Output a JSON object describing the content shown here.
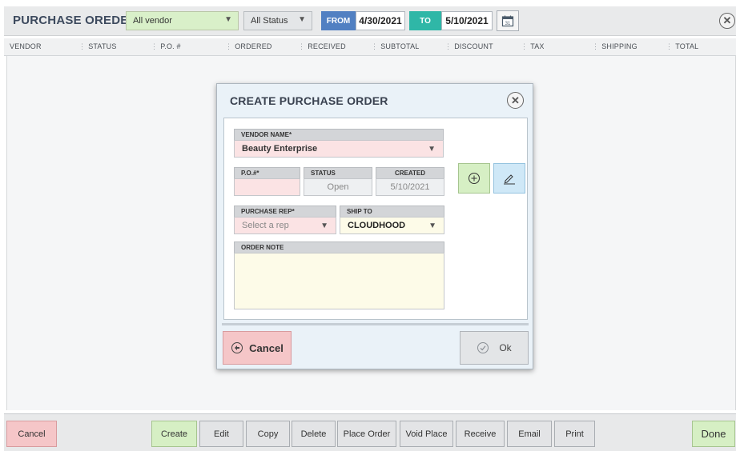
{
  "header": {
    "title": "PURCHASE OREDER",
    "vendor_filter": "All vendor",
    "status_filter": "All Status",
    "from_label": "FROM",
    "from_date": "4/30/2021",
    "to_label": "TO",
    "to_date": "5/10/2021",
    "calendar_day": "31"
  },
  "columns": [
    "VENDOR",
    "STATUS",
    "P.O. #",
    "ORDERED",
    "RECEIVED",
    "SUBTOTAL",
    "DISCOUNT",
    "TAX",
    "SHIPPING",
    "TOTAL"
  ],
  "modal": {
    "title": "CREATE PURCHASE ORDER",
    "vendor_name_label": "VENDOR NAME*",
    "vendor_name_value": "Beauty Enterprise",
    "po_label": "P.O.#*",
    "po_value": "",
    "status_label": "STATUS",
    "status_value": "Open",
    "created_label": "CREATED",
    "created_value": "5/10/2021",
    "purchase_rep_label": "PURCHASE REP*",
    "purchase_rep_placeholder": "Select a rep",
    "ship_to_label": "SHIP TO",
    "ship_to_value": "CLOUDHOOD",
    "order_note_label": "ORDER NOTE",
    "order_note_value": "",
    "cancel_label": "Cancel",
    "ok_label": "Ok"
  },
  "bottom": {
    "cancel": "Cancel",
    "create": "Create",
    "edit": "Edit",
    "copy": "Copy",
    "delete": "Delete",
    "place_order": "Place Order",
    "void_place": "Void Place",
    "receive": "Receive",
    "email": "Email",
    "print": "Print",
    "done": "Done"
  }
}
